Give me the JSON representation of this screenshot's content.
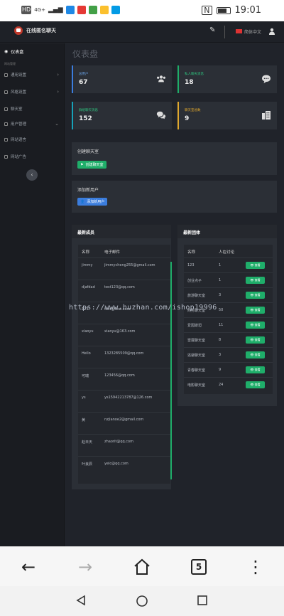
{
  "statusbar": {
    "left_icons": [
      "HD",
      "4G",
      "signal",
      "app1",
      "app2",
      "app3",
      "app4",
      "app5"
    ],
    "net_label": "4G+",
    "time": "19:01"
  },
  "header": {
    "brand": "在线匿名聊天",
    "language": "简体中文"
  },
  "sidebar": {
    "active": "仪表盘",
    "section": "网站管理",
    "items": [
      {
        "label": "通用设置",
        "has_arrow": true
      },
      {
        "label": "风格设置",
        "has_arrow": true
      },
      {
        "label": "聊天室",
        "has_arrow": false
      },
      {
        "label": "用户管理",
        "has_arrow": true
      },
      {
        "label": "网站语言",
        "has_arrow": false
      },
      {
        "label": "网站广告",
        "has_arrow": false
      }
    ],
    "collapse_glyph": "‹"
  },
  "main": {
    "title": "仪表盘",
    "stats": [
      {
        "label": "总用户",
        "value": "67",
        "accent": "#3b7ddd",
        "icon": "users-icon"
      },
      {
        "label": "私人聊天消息",
        "value": "18",
        "accent": "#1fae6a",
        "icon": "chat-bubble-icon"
      },
      {
        "label": "群组聊天消息",
        "value": "152",
        "accent": "#3b7ddd",
        "icon": "comments-icon"
      },
      {
        "label": "聊天室总数",
        "value": "9",
        "accent": "#e0a82e",
        "icon": "building-icon"
      }
    ],
    "create_room": {
      "title": "创建聊天室",
      "button": "创建聊天室"
    },
    "add_user": {
      "title": "添加新用户",
      "button": "添加新用户"
    },
    "members": {
      "title": "最新成员",
      "headers": [
        "名称",
        "电子邮件"
      ],
      "rows": [
        [
          "jimmy",
          "jimmycheng255@gmail.com"
        ],
        [
          "djafdad",
          "test123@qq.com"
        ],
        [
          "123",
          "test@test.com"
        ],
        [
          "xiaoyu",
          "xiaoyu@163.com"
        ],
        [
          "Hello",
          "1323285509@qq.com"
        ],
        [
          "可瑞",
          "123456@qq.com"
        ],
        [
          "ys",
          "ys15942213787@126.com"
        ],
        [
          "黄",
          "nzjianoe2@gmail.com"
        ],
        [
          "赵日天",
          "zhaorit@qq.com"
        ],
        [
          "叶良辰",
          "yelc@qq.com"
        ]
      ]
    },
    "groups": {
      "title": "最新团体",
      "headers": [
        "名称",
        "人在讨论"
      ],
      "view_label": "查看",
      "rows": [
        [
          "123",
          "1"
        ],
        [
          "创业点子",
          "1"
        ],
        [
          "旅游聊天室",
          "3"
        ],
        [
          "商务聊天室",
          "50"
        ],
        [
          "爱因斯坦",
          "11"
        ],
        [
          "雷霆聊天室",
          "8"
        ],
        [
          "逃避聊天室",
          "3"
        ],
        [
          "青春聊天室",
          "9"
        ],
        [
          "电影聊天室",
          "24"
        ]
      ]
    }
  },
  "watermark": "https://www.huzhan.com/ishop19996",
  "browser": {
    "tab_count": "5"
  }
}
